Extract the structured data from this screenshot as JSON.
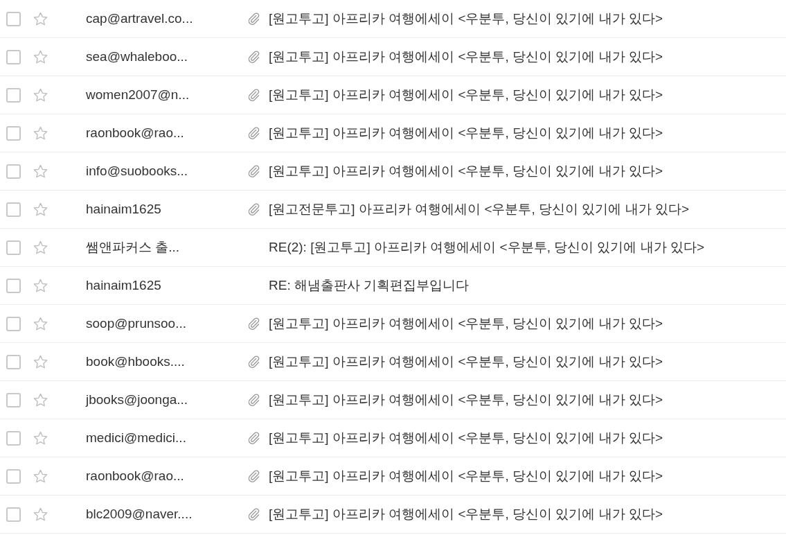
{
  "messages": [
    {
      "checked": false,
      "starred": false,
      "sender": "cap@artravel.co...",
      "attachment": true,
      "subject": "[원고투고] 아프리카 여행에세이 <우분투, 당신이 있기에 내가 있다>"
    },
    {
      "checked": false,
      "starred": false,
      "sender": "sea@whaleboo...",
      "attachment": true,
      "subject": "[원고투고] 아프리카 여행에세이 <우분투, 당신이 있기에 내가 있다>"
    },
    {
      "checked": false,
      "starred": false,
      "sender": "women2007@n...",
      "attachment": true,
      "subject": "[원고투고] 아프리카 여행에세이 <우분투, 당신이 있기에 내가 있다>"
    },
    {
      "checked": false,
      "starred": false,
      "sender": "raonbook@rao...",
      "attachment": true,
      "subject": "[원고투고] 아프리카 여행에세이 <우분투, 당신이 있기에 내가 있다>"
    },
    {
      "checked": false,
      "starred": false,
      "sender": "info@suobooks...",
      "attachment": true,
      "subject": "[원고투고] 아프리카 여행에세이 <우분투, 당신이 있기에 내가 있다>"
    },
    {
      "checked": false,
      "starred": false,
      "sender": "hainaim1625",
      "attachment": true,
      "subject": "[원고전문투고] 아프리카 여행에세이 <우분투, 당신이 있기에 내가 있다>"
    },
    {
      "checked": false,
      "starred": false,
      "sender": "쌤앤파커스 출...",
      "attachment": false,
      "subject": "RE(2): [원고투고] 아프리카 여행에세이 <우분투, 당신이 있기에 내가 있다>"
    },
    {
      "checked": false,
      "starred": false,
      "sender": "hainaim1625",
      "attachment": false,
      "subject": "RE: 해냄출판사 기획편집부입니다"
    },
    {
      "checked": false,
      "starred": false,
      "sender": "soop@prunsoo...",
      "attachment": true,
      "subject": "[원고투고] 아프리카 여행에세이 <우분투, 당신이 있기에 내가 있다>"
    },
    {
      "checked": false,
      "starred": false,
      "sender": "book@hbooks....",
      "attachment": true,
      "subject": "[원고투고] 아프리카 여행에세이 <우분투, 당신이 있기에 내가 있다>"
    },
    {
      "checked": false,
      "starred": false,
      "sender": "jbooks@joonga...",
      "attachment": true,
      "subject": "[원고투고] 아프리카 여행에세이 <우분투, 당신이 있기에 내가 있다>"
    },
    {
      "checked": false,
      "starred": false,
      "sender": "medici@medici...",
      "attachment": true,
      "subject": "[원고투고] 아프리카 여행에세이 <우분투, 당신이 있기에 내가 있다>"
    },
    {
      "checked": false,
      "starred": false,
      "sender": "raonbook@rao...",
      "attachment": true,
      "subject": "[원고투고] 아프리카 여행에세이 <우분투, 당신이 있기에 내가 있다>"
    },
    {
      "checked": false,
      "starred": false,
      "sender": "blc2009@naver....",
      "attachment": true,
      "subject": "[원고투고] 아프리카 여행에세이 <우분투, 당신이 있기에 내가 있다>"
    }
  ]
}
